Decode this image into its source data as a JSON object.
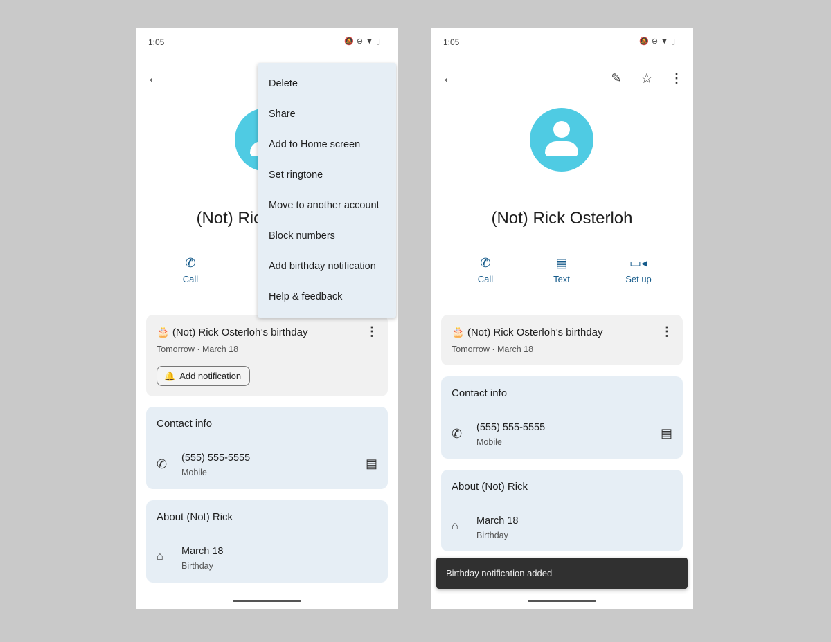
{
  "status": {
    "time": "1:05",
    "icons": [
      "bell-off-icon",
      "dnd-icon",
      "wifi-icon",
      "battery-icon"
    ]
  },
  "contact": {
    "name": "(Not) Rick Osterloh",
    "birthday_title": "(Not) Rick Osterloh’s birthday",
    "birthday_sub": "Tomorrow · March 18",
    "add_notification": "Add notification"
  },
  "actions": {
    "call": "Call",
    "text": "Text",
    "setup": "Set up"
  },
  "contact_info": {
    "title": "Contact info",
    "phone": "(555) 555-5555",
    "phone_type": "Mobile"
  },
  "about": {
    "title": "About (Not) Rick",
    "date": "March 18",
    "date_type": "Birthday"
  },
  "menu": {
    "items": [
      "Delete",
      "Share",
      "Add to Home screen",
      "Set ringtone",
      "Move to another account",
      "Block numbers",
      "Add birthday notification",
      "Help & feedback"
    ]
  },
  "snackbar": {
    "text": "Birthday notification added"
  },
  "colors": {
    "avatar": "#4fcbe3",
    "accent": "#145a8a",
    "card": "#e6eef5"
  }
}
